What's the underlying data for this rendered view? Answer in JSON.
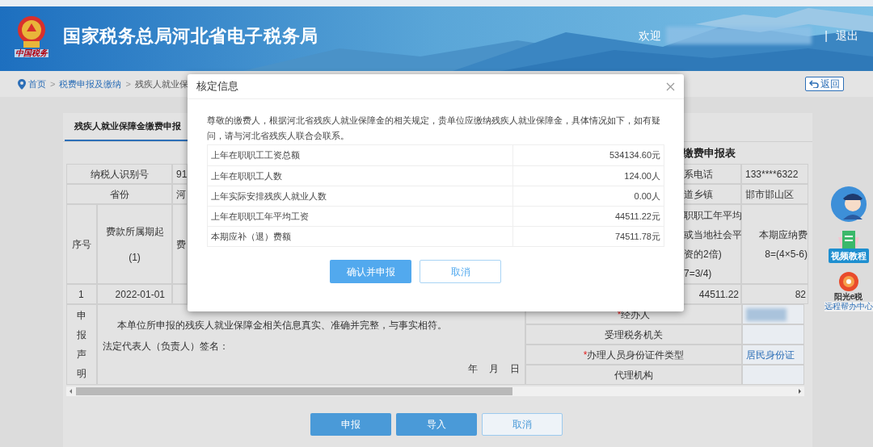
{
  "header": {
    "emblem_caption": "中国税务",
    "title": "国家税务总局河北省电子税务局",
    "welcome": "欢迎",
    "separator": "|",
    "logout": "退出"
  },
  "breadcrumb": {
    "separator": ">",
    "items": [
      {
        "label": "首页",
        "link": true
      },
      {
        "label": "税费申报及缴纳",
        "link": true
      },
      {
        "label": "残疾人就业保",
        "link": false
      }
    ]
  },
  "back_button": "返回",
  "tab": {
    "label": "残疾人就业保障金缴费申报",
    "selected": true
  },
  "form_left": {
    "rows": [
      {
        "label": "纳税人识别号",
        "value": "91"
      },
      {
        "label": "省份",
        "value": "河"
      }
    ],
    "columns": [
      {
        "lines": [
          "序号"
        ]
      },
      {
        "lines": [
          "费款所属期起",
          "(1)"
        ]
      }
    ],
    "column_3": "费",
    "data_row": [
      "1",
      "2022-01-01"
    ]
  },
  "form_right": {
    "title": "缴费申报表",
    "rows": [
      {
        "label": "系电话",
        "value": "133****6322"
      },
      {
        "label": "道乡镇",
        "value": "邯市邯山区"
      }
    ],
    "columns": [
      {
        "lines": [
          "职职工年平均",
          "或当地社会平",
          "资的2倍)",
          "7=3/4)"
        ]
      },
      {
        "lines": [
          "本期应纳费",
          "8=(4×5-6)"
        ]
      }
    ],
    "data_row": [
      "44511.22",
      "82"
    ]
  },
  "declaration": {
    "heading": "申报声明",
    "statement": "本单位所申报的残疾人就业保障金相关信息真实、准确并完整，与事实相符。",
    "signature": "法定代表人（负责人）签名：",
    "date": [
      "年",
      "月",
      "日"
    ]
  },
  "required_mark": "*",
  "handler_rows": [
    {
      "label": "经办人",
      "required": true,
      "redacted": true
    },
    {
      "label": "受理税务机关",
      "required": false,
      "redacted": false
    },
    {
      "label": "办理人员身份证件类型",
      "required": true,
      "redacted": false,
      "value": "居民身份证"
    },
    {
      "label": "代理机构",
      "required": false,
      "redacted": false
    }
  ],
  "buttons": [
    {
      "label": "申报",
      "kind": "primary"
    },
    {
      "label": "导入",
      "kind": "primary"
    },
    {
      "label": "取消",
      "kind": "outline"
    }
  ],
  "side_tools": [
    {
      "kind": "avatar"
    },
    {
      "kind": "video",
      "label": "视频教程"
    },
    {
      "kind": "help",
      "label": "阳光e税",
      "sublabel": "远程帮办中心"
    }
  ],
  "modal": {
    "title": "核定信息",
    "message": "尊敬的缴费人，根据河北省残疾人就业保障金的相关规定，贵单位应缴纳残疾人就业保障金，具体情况如下，如有疑问，请与河北省残疾人联合会联系。",
    "rows": [
      {
        "label": "上年在职职工工资总额",
        "value": "534134.60元"
      },
      {
        "label": "上年在职职工人数",
        "value": "124.00人"
      },
      {
        "label": "上年实际安排残疾人就业人数",
        "value": "0.00人"
      },
      {
        "label": "上年在职职工年平均工资",
        "value": "44511.22元"
      },
      {
        "label": "本期应补（退）费额",
        "value": "74511.78元"
      }
    ],
    "buttons": [
      {
        "label": "确认并申报",
        "kind": "primary"
      },
      {
        "label": "取消",
        "kind": "outline"
      }
    ]
  }
}
